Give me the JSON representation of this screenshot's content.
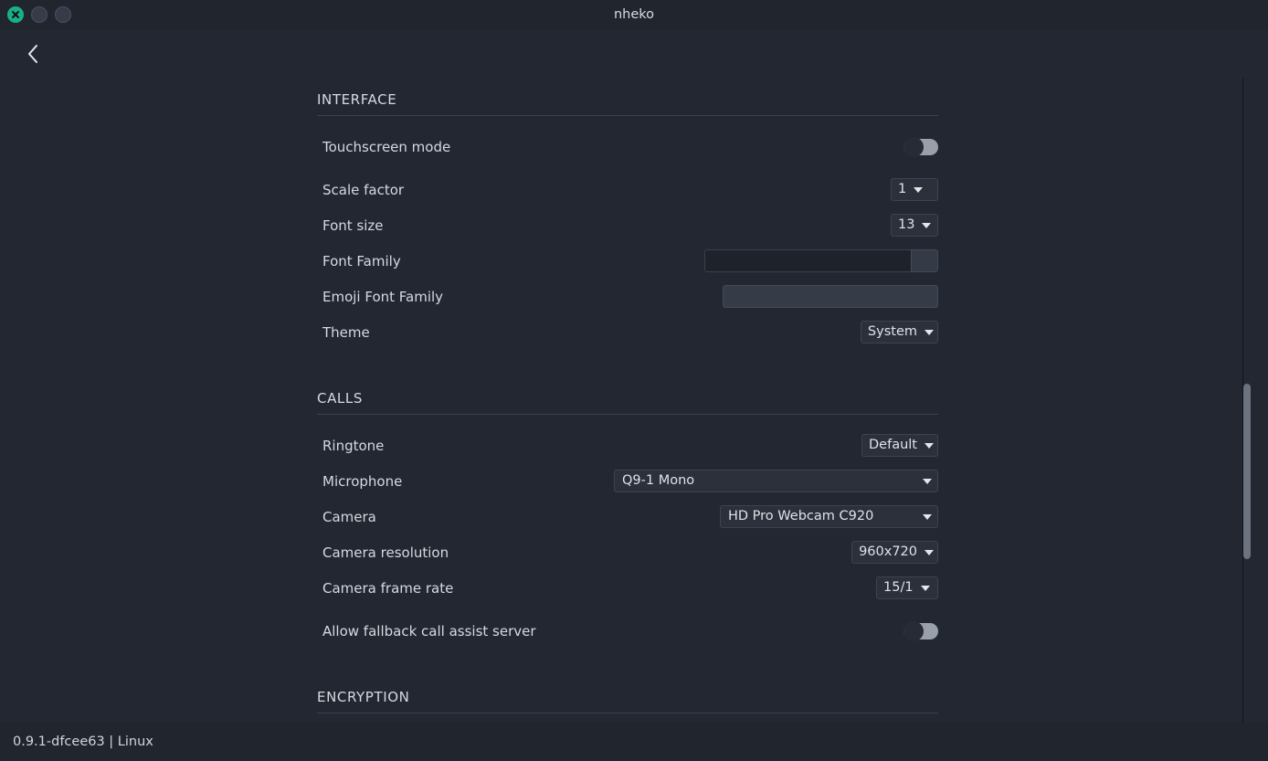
{
  "window": {
    "title": "nheko",
    "controls": {
      "close_label": "close-window",
      "minimize_label": "minimize-window",
      "maximize_label": "maximize-window"
    }
  },
  "nav": {
    "back_label": "Back"
  },
  "sections": [
    {
      "id": "interface",
      "title": "INTERFACE",
      "rows": [
        {
          "id": "touchscreen-mode",
          "label": "Touchscreen mode",
          "control": "toggle",
          "value": "off"
        },
        {
          "id": "scale-factor",
          "label": "Scale factor",
          "control": "combo",
          "value": "1"
        },
        {
          "id": "font-size",
          "label": "Font size",
          "control": "combo",
          "value": "13"
        },
        {
          "id": "font-family",
          "label": "Font Family",
          "control": "combo-edit",
          "value": "",
          "placeholder": ""
        },
        {
          "id": "emoji-font-family",
          "label": "Emoji Font Family",
          "control": "combo-edit-flat",
          "value": "",
          "placeholder": ""
        },
        {
          "id": "theme",
          "label": "Theme",
          "control": "combo",
          "value": "System"
        }
      ]
    },
    {
      "id": "calls",
      "title": "CALLS",
      "rows": [
        {
          "id": "ringtone",
          "label": "Ringtone",
          "control": "combo",
          "value": "Default"
        },
        {
          "id": "microphone",
          "label": "Microphone",
          "control": "combo-wide",
          "value": "Q9-1 Mono"
        },
        {
          "id": "camera",
          "label": "Camera",
          "control": "combo-wide",
          "value": "HD Pro Webcam C920"
        },
        {
          "id": "camera-resolution",
          "label": "Camera resolution",
          "control": "combo",
          "value": "960x720"
        },
        {
          "id": "camera-frame-rate",
          "label": "Camera frame rate",
          "control": "combo",
          "value": "15/1"
        },
        {
          "id": "allow-fallback-call-assist-server",
          "label": "Allow fallback call assist server",
          "control": "toggle",
          "value": "off"
        }
      ]
    },
    {
      "id": "encryption",
      "title": "ENCRYPTION",
      "rows": []
    }
  ],
  "scrollbar": {
    "position": "middle"
  },
  "status": {
    "text": "0.9.1-dfcee63 | Linux"
  },
  "colors": {
    "background": "#232731",
    "titlebar": "#21252e",
    "accent_close": "#18b08a",
    "text": "#d6d9df",
    "separator": "#3b4049",
    "combo_bg": "#2b303b",
    "scrollbar_thumb": "#6b7280"
  }
}
